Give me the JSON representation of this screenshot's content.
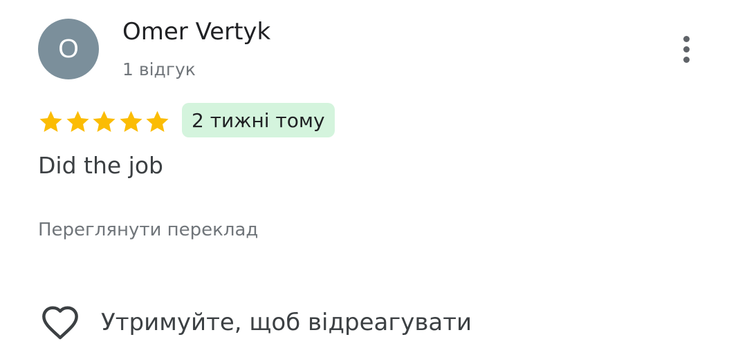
{
  "review": {
    "avatar_initial": "O",
    "avatar_color": "#7b8f9b",
    "reviewer_name": "Omer Vertyk",
    "review_count": "1 відгук",
    "menu_icon": "more-vertical-icon",
    "rating": 5,
    "rating_max": 5,
    "star_color": "#fbbc04",
    "time_ago": "2 тижні тому",
    "time_badge_color": "#d4f4dd",
    "text": "Did the job",
    "translate_label": "Переглянути переклад",
    "react_icon": "heart-outline-icon",
    "react_label": "Утримуйте, щоб відреагувати"
  }
}
